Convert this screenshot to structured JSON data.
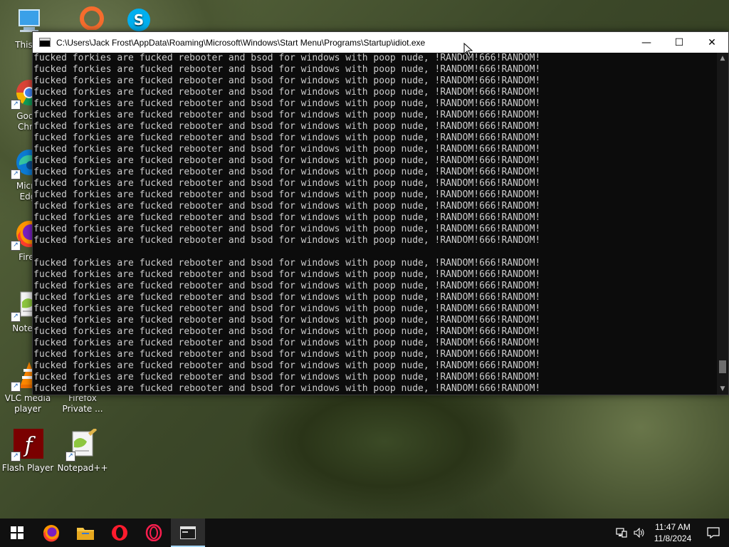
{
  "window": {
    "title": "C:\\Users\\Jack Frost\\AppData\\Roaming\\Microsoft\\Windows\\Start Menu\\Programs\\Startup\\idiot.exe",
    "minimize_glyph": "—",
    "maximize_glyph": "☐",
    "close_glyph": "✕"
  },
  "console": {
    "line_text": "fucked forkies are fucked rebooter and bsod for windows with poop nude, !RANDOM!666!RANDOM!",
    "lines": [
      "fucked forkies are fucked rebooter and bsod for windows with poop nude, !RANDOM!666!RANDOM!",
      "fucked forkies are fucked rebooter and bsod for windows with poop nude, !RANDOM!666!RANDOM!",
      "fucked forkies are fucked rebooter and bsod for windows with poop nude, !RANDOM!666!RANDOM!",
      "fucked forkies are fucked rebooter and bsod for windows with poop nude, !RANDOM!666!RANDOM!",
      "fucked forkies are fucked rebooter and bsod for windows with poop nude, !RANDOM!666!RANDOM!",
      "fucked forkies are fucked rebooter and bsod for windows with poop nude, !RANDOM!666!RANDOM!",
      "fucked forkies are fucked rebooter and bsod for windows with poop nude, !RANDOM!666!RANDOM!",
      "fucked forkies are fucked rebooter and bsod for windows with poop nude, !RANDOM!666!RANDOM!",
      "fucked forkies are fucked rebooter and bsod for windows with poop nude, !RANDOM!666!RANDOM!",
      "fucked forkies are fucked rebooter and bsod for windows with poop nude, !RANDOM!666!RANDOM!",
      "fucked forkies are fucked rebooter and bsod for windows with poop nude, !RANDOM!666!RANDOM!",
      "fucked forkies are fucked rebooter and bsod for windows with poop nude, !RANDOM!666!RANDOM!",
      "fucked forkies are fucked rebooter and bsod for windows with poop nude, !RANDOM!666!RANDOM!",
      "fucked forkies are fucked rebooter and bsod for windows with poop nude, !RANDOM!666!RANDOM!",
      "fucked forkies are fucked rebooter and bsod for windows with poop nude, !RANDOM!666!RANDOM!",
      "fucked forkies are fucked rebooter and bsod for windows with poop nude, !RANDOM!666!RANDOM!",
      "fucked forkies are fucked rebooter and bsod for windows with poop nude, !RANDOM!666!RANDOM!",
      "",
      "fucked forkies are fucked rebooter and bsod for windows with poop nude, !RANDOM!666!RANDOM!",
      "fucked forkies are fucked rebooter and bsod for windows with poop nude, !RANDOM!666!RANDOM!",
      "fucked forkies are fucked rebooter and bsod for windows with poop nude, !RANDOM!666!RANDOM!",
      "fucked forkies are fucked rebooter and bsod for windows with poop nude, !RANDOM!666!RANDOM!",
      "fucked forkies are fucked rebooter and bsod for windows with poop nude, !RANDOM!666!RANDOM!",
      "fucked forkies are fucked rebooter and bsod for windows with poop nude, !RANDOM!666!RANDOM!",
      "fucked forkies are fucked rebooter and bsod for windows with poop nude, !RANDOM!666!RANDOM!",
      "fucked forkies are fucked rebooter and bsod for windows with poop nude, !RANDOM!666!RANDOM!",
      "fucked forkies are fucked rebooter and bsod for windows with poop nude, !RANDOM!666!RANDOM!",
      "fucked forkies are fucked rebooter and bsod for windows with poop nude, !RANDOM!666!RANDOM!",
      "fucked forkies are fucked rebooter and bsod for windows with poop nude, !RANDOM!666!RANDOM!",
      "fucked forkies are fucked rebooter and bsod for windows with poop nude, !RANDOM!666!RANDOM!"
    ],
    "scroll_position_fraction": 0.97
  },
  "desktop": {
    "icons": [
      {
        "label": "This P",
        "icon": "computer-icon"
      },
      {
        "label": "Goog\nChro",
        "icon": "chrome-icon"
      },
      {
        "label": "Micro\nEdg",
        "icon": "edge-icon"
      },
      {
        "label": "Firef",
        "icon": "firefox-icon"
      },
      {
        "label": "Notepa",
        "icon": "notepadpp-icon"
      },
      {
        "label": "VLC media\nplayer",
        "icon": "vlc-icon"
      },
      {
        "label": "Firefox\nPrivate ...",
        "icon": "firefox-private-icon"
      },
      {
        "label": "Flash Player",
        "icon": "flash-icon"
      },
      {
        "label": "Notepad++",
        "icon": "notepadpp-icon"
      }
    ],
    "top_icons": [
      {
        "icon": "origin-icon",
        "color": "#f56c2d"
      },
      {
        "icon": "skype-icon",
        "color": "#00aff0"
      }
    ]
  },
  "taskbar": {
    "items": [
      {
        "icon": "windows-start-icon"
      },
      {
        "icon": "firefox-icon"
      },
      {
        "icon": "file-explorer-icon"
      },
      {
        "icon": "opera-icon"
      },
      {
        "icon": "opera-gx-icon"
      },
      {
        "icon": "console-icon",
        "active": true
      }
    ],
    "time": "11:47 AM",
    "date": "11/8/2024"
  },
  "colors": {
    "console_bg": "#0c0c0c",
    "console_fg": "#cccccc",
    "taskbar_bg": "#101010",
    "accent": "#a6d8ff"
  }
}
